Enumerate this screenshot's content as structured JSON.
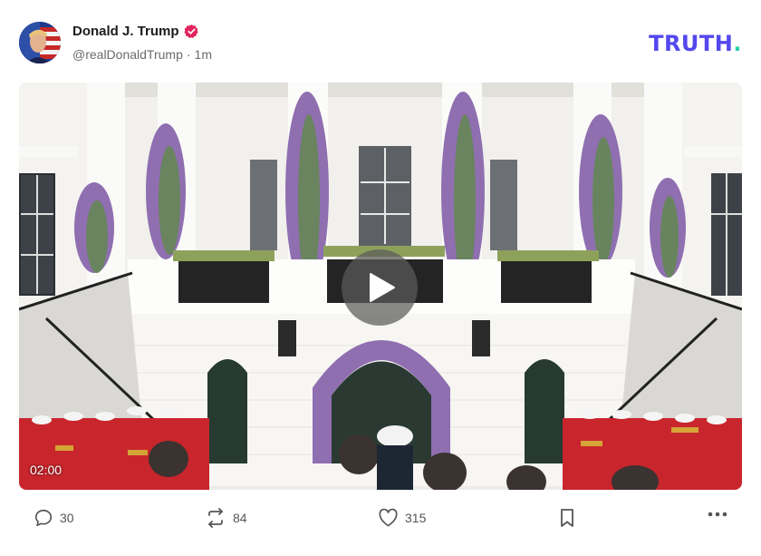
{
  "post": {
    "author": {
      "display_name": "Donald J. Trump",
      "handle": "@realDonaldTrump",
      "separator": "·",
      "time": "1m",
      "verified_icon": "verified-badge-icon"
    },
    "brand": {
      "text": "TRUTH",
      "dot": ".",
      "color": "#5448ee",
      "dot_color": "#2ad0a8"
    },
    "media": {
      "type": "video",
      "duration": "02:00",
      "play_icon": "play-icon"
    },
    "actions": {
      "replies": "30",
      "retruths": "84",
      "likes": "315",
      "bookmark_icon": "bookmark-icon",
      "more_icon": "more-icon"
    }
  },
  "colors": {
    "verified_badge": "#e0245e",
    "action_text": "#555555",
    "handle_text": "#6b6b6b"
  }
}
